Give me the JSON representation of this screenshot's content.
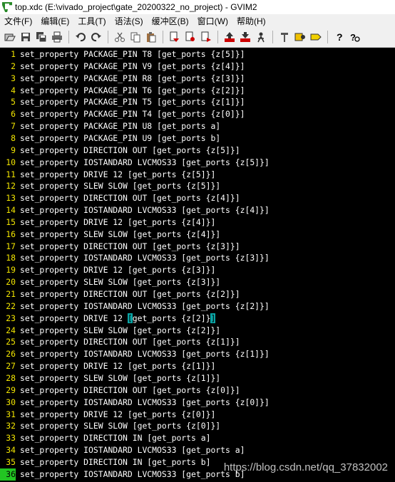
{
  "window": {
    "title": "top.xdc (E:\\vivado_project\\gate_20200322_no_project) - GVIM2"
  },
  "menu": [
    "文件(F)",
    "编辑(E)",
    "工具(T)",
    "语法(S)",
    "缓冲区(B)",
    "窗口(W)",
    "帮助(H)"
  ],
  "toolbar_icons": [
    "open-icon",
    "save-icon",
    "save-all-icon",
    "print-icon",
    "undo-icon",
    "redo-icon",
    "cut-icon",
    "copy-icon",
    "paste-icon",
    "replace-icon",
    "find-next-icon",
    "find-prev-icon",
    "load-session-icon",
    "save-session-icon",
    "run-script-icon",
    "make-icon",
    "shell-icon",
    "tags-icon",
    "help-icon",
    "find-help-icon"
  ],
  "editor": {
    "lines": [
      {
        "n": "1",
        "text": "set_property PACKAGE_PIN T8 [get_ports {z[5]}]"
      },
      {
        "n": "2",
        "text": "set_property PACKAGE_PIN V9 [get_ports {z[4]}]"
      },
      {
        "n": "3",
        "text": "set_property PACKAGE_PIN R8 [get_ports {z[3]}]"
      },
      {
        "n": "4",
        "text": "set_property PACKAGE_PIN T6 [get_ports {z[2]}]"
      },
      {
        "n": "5",
        "text": "set_property PACKAGE_PIN T5 [get_ports {z[1]}]"
      },
      {
        "n": "6",
        "text": "set_property PACKAGE_PIN T4 [get_ports {z[0]}]"
      },
      {
        "n": "7",
        "text": "set_property PACKAGE_PIN U8 [get_ports a]"
      },
      {
        "n": "8",
        "text": "set_property PACKAGE_PIN U9 [get_ports b]"
      },
      {
        "n": "9",
        "text": "set_property DIRECTION OUT [get_ports {z[5]}]"
      },
      {
        "n": "10",
        "text": "set_property IOSTANDARD LVCMOS33 [get_ports {z[5]}]"
      },
      {
        "n": "11",
        "text": "set_property DRIVE 12 [get_ports {z[5]}]"
      },
      {
        "n": "12",
        "text": "set_property SLEW SLOW [get_ports {z[5]}]"
      },
      {
        "n": "13",
        "text": "set_property DIRECTION OUT [get_ports {z[4]}]"
      },
      {
        "n": "14",
        "text": "set_property IOSTANDARD LVCMOS33 [get_ports {z[4]}]"
      },
      {
        "n": "15",
        "text": "set_property DRIVE 12 [get_ports {z[4]}]"
      },
      {
        "n": "16",
        "text": "set_property SLEW SLOW [get_ports {z[4]}]"
      },
      {
        "n": "17",
        "text": "set_property DIRECTION OUT [get_ports {z[3]}]"
      },
      {
        "n": "18",
        "text": "set_property IOSTANDARD LVCMOS33 [get_ports {z[3]}]"
      },
      {
        "n": "19",
        "text": "set_property DRIVE 12 [get_ports {z[3]}]"
      },
      {
        "n": "20",
        "text": "set_property SLEW SLOW [get_ports {z[3]}]"
      },
      {
        "n": "21",
        "text": "set_property DIRECTION OUT [get_ports {z[2]}]"
      },
      {
        "n": "22",
        "text": "set_property IOSTANDARD LVCMOS33 [get_ports {z[2]}]"
      },
      {
        "n": "23",
        "text": "set_property DRIVE 12 [get_ports {z[2]}]"
      },
      {
        "n": "24",
        "text": "set_property SLEW SLOW [get_ports {z[2]}]"
      },
      {
        "n": "25",
        "text": "set_property DIRECTION OUT [get_ports {z[1]}]"
      },
      {
        "n": "26",
        "text": "set_property IOSTANDARD LVCMOS33 [get_ports {z[1]}]"
      },
      {
        "n": "27",
        "text": "set_property DRIVE 12 [get_ports {z[1]}]"
      },
      {
        "n": "28",
        "text": "set_property SLEW SLOW [get_ports {z[1]}]"
      },
      {
        "n": "29",
        "text": "set_property DIRECTION OUT [get_ports {z[0]}]"
      },
      {
        "n": "30",
        "text": "set_property IOSTANDARD LVCMOS33 [get_ports {z[0]}]"
      },
      {
        "n": "31",
        "text": "set_property DRIVE 12 [get_ports {z[0]}]"
      },
      {
        "n": "32",
        "text": "set_property SLEW SLOW [get_ports {z[0]}]"
      },
      {
        "n": "33",
        "text": "set_property DIRECTION IN [get_ports a]"
      },
      {
        "n": "34",
        "text": "set_property IOSTANDARD LVCMOS33 [get_ports a]"
      },
      {
        "n": "35",
        "text": "set_property DIRECTION IN [get_ports b]"
      },
      {
        "n": "36",
        "text": "set_property IOSTANDARD LVCMOS33 [get_ports b]"
      }
    ],
    "bracket_match_line": "23",
    "cursor_line": "36"
  },
  "watermark": "https://blog.csdn.net/qq_37832002",
  "colors": {
    "line_number": "#f2e500",
    "text": "#ffffff",
    "background": "#000000",
    "bracket_highlight": "#0aa6a6",
    "cursor_line_number_bg": "#22c522"
  }
}
